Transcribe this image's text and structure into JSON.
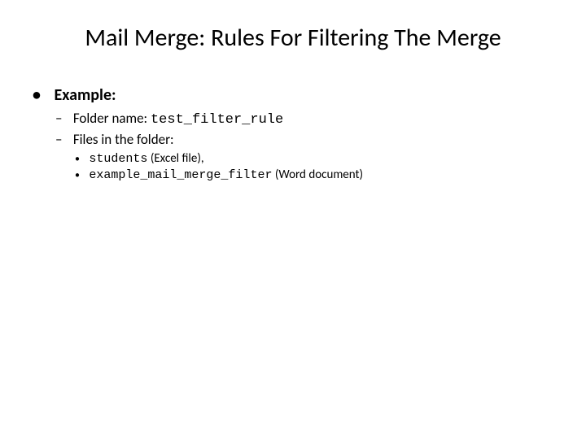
{
  "title": "Mail Merge: Rules For Filtering The Merge",
  "bullets": {
    "example_label": "Example:",
    "folder_name_label": "Folder name: ",
    "folder_name_value": "test_filter_rule",
    "files_label": "Files in the folder:",
    "file1_name": "students",
    "file1_desc": " (Excel file), ",
    "file2_name": "example_mail_merge_filter",
    "file2_desc": "  (Word document)"
  }
}
